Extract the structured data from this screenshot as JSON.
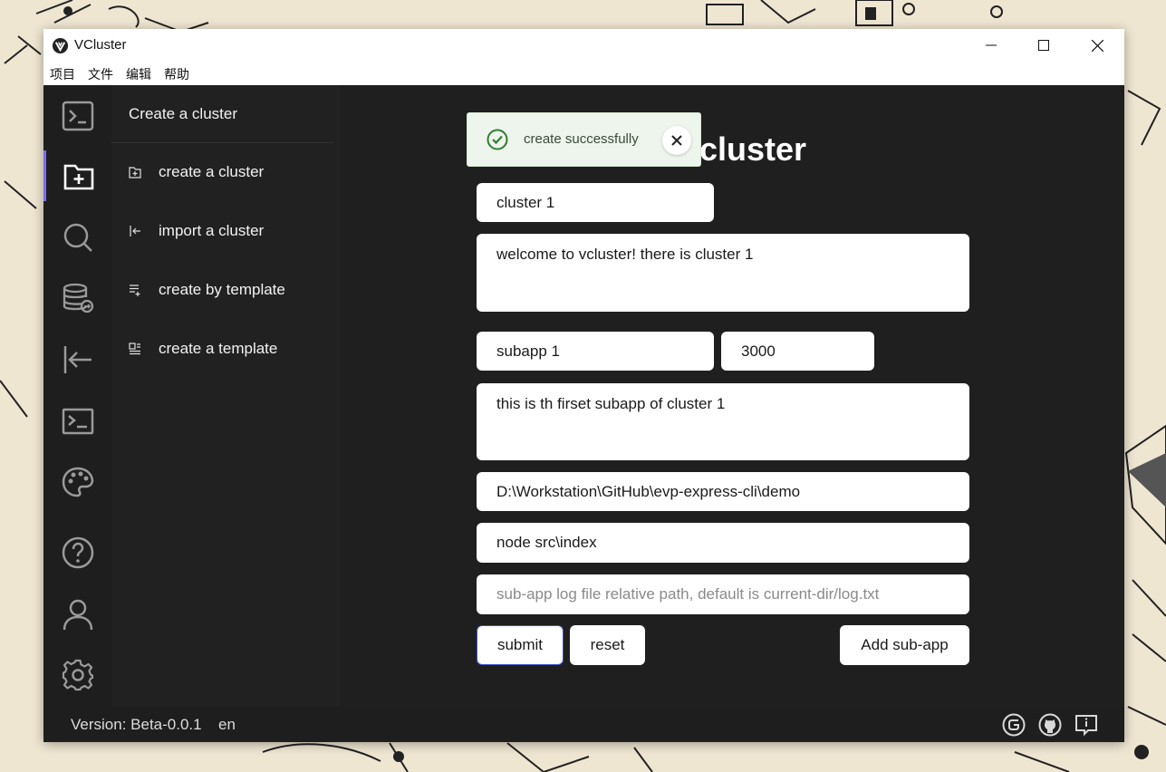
{
  "window": {
    "title": "VCluster"
  },
  "menubar": {
    "items": [
      "项目",
      "文件",
      "编辑",
      "帮助"
    ]
  },
  "rail": {
    "icons": [
      "terminal-box-icon",
      "folder-add-icon",
      "search-icon",
      "database-add-icon",
      "import-icon",
      "terminal-icon",
      "palette-icon",
      "help-icon",
      "user-icon",
      "settings-icon"
    ],
    "accent": "#7c6cf0"
  },
  "subnav": {
    "title": "Create a cluster",
    "items": [
      {
        "label": "create a cluster",
        "icon": "file-add-icon"
      },
      {
        "label": "import a cluster",
        "icon": "import-icon"
      },
      {
        "label": "create by template",
        "icon": "list-add-icon"
      },
      {
        "label": "create a template",
        "icon": "template-icon"
      }
    ]
  },
  "main": {
    "heading": "cluster",
    "cluster_name": "cluster 1",
    "cluster_description": "welcome to vcluster! there is cluster 1",
    "subapp_name": "subapp 1",
    "subapp_port": "3000",
    "subapp_description": "this is th firset subapp of cluster 1",
    "work_dir": "D:\\Workstation\\GitHub\\evp-express-cli\\demo",
    "command": "node src\\index",
    "log_path_placeholder": "sub-app log file relative path, default is current-dir/log.txt",
    "submit_label": "submit",
    "reset_label": "reset",
    "add_subapp_label": "Add sub-app"
  },
  "toast": {
    "message": "create successfully",
    "color": "#2e7d32"
  },
  "statusbar": {
    "version": "Version: Beta-0.0.1",
    "language": "en"
  }
}
